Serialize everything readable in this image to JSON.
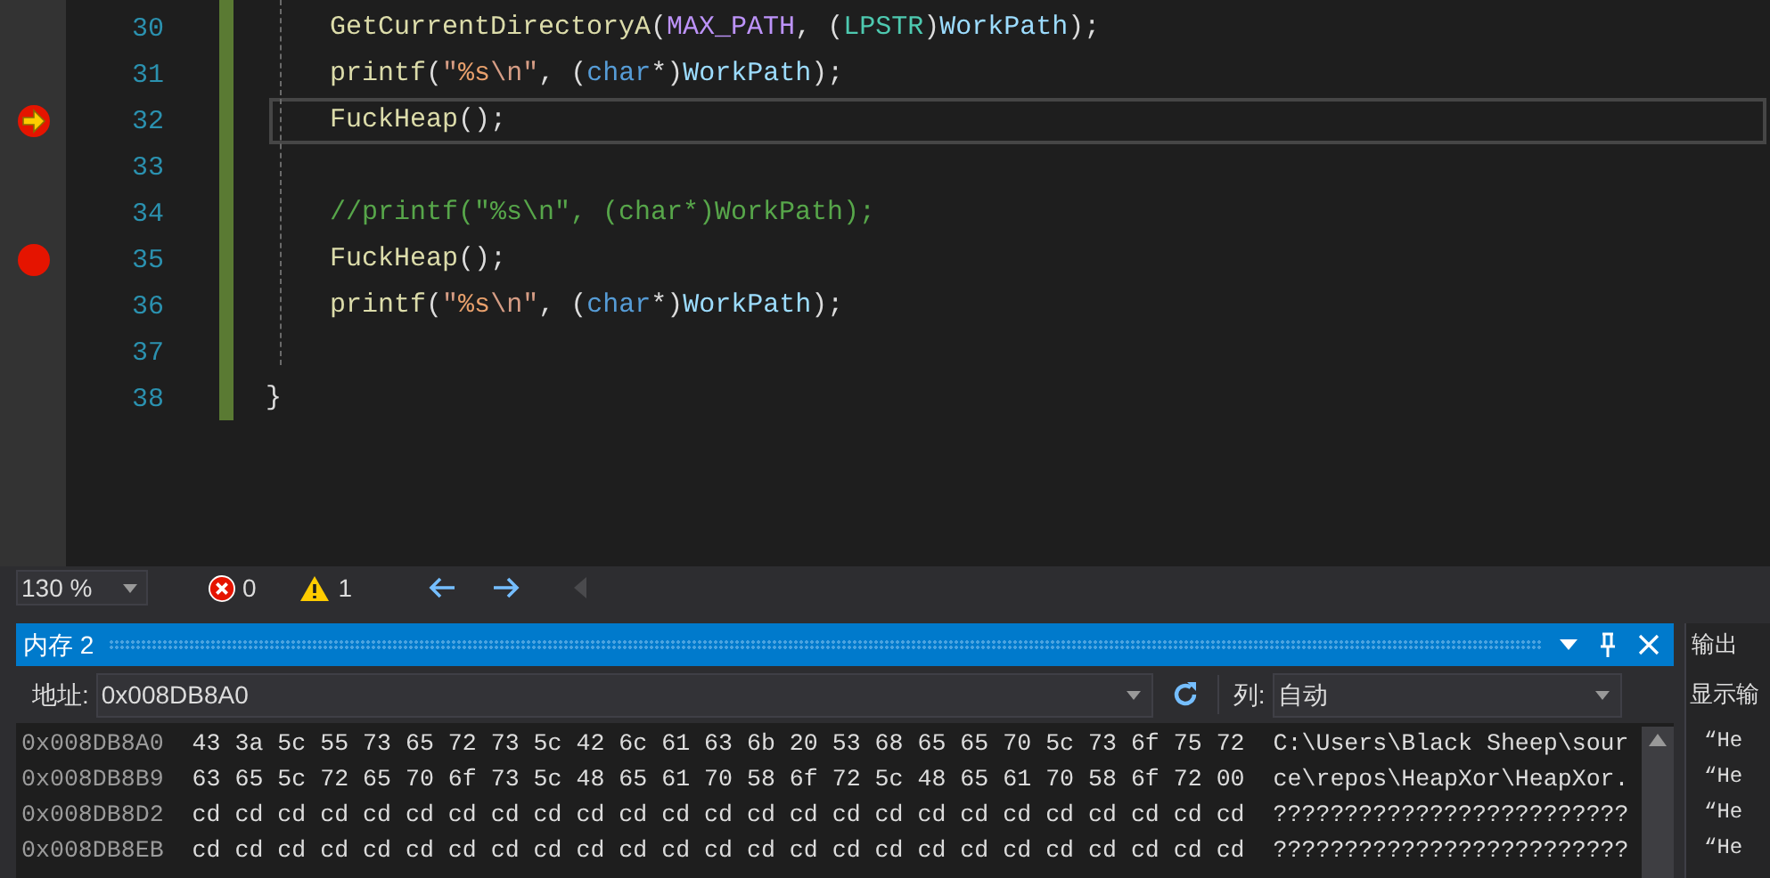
{
  "editor": {
    "lines": [
      {
        "number": "30",
        "breakpoint": false,
        "current": false,
        "tokens": [
          {
            "text": "GetCurrentDirectoryA",
            "kind": "func"
          },
          {
            "text": "(",
            "kind": "plain"
          },
          {
            "text": "MAX_PATH",
            "kind": "macro"
          },
          {
            "text": ", (",
            "kind": "plain"
          },
          {
            "text": "LPSTR",
            "kind": "type"
          },
          {
            "text": ")",
            "kind": "plain"
          },
          {
            "text": "WorkPath",
            "kind": "var"
          },
          {
            "text": ");",
            "kind": "plain"
          }
        ]
      },
      {
        "number": "31",
        "breakpoint": false,
        "current": false,
        "tokens": [
          {
            "text": "printf",
            "kind": "func"
          },
          {
            "text": "(",
            "kind": "plain"
          },
          {
            "text": "\"",
            "kind": "string"
          },
          {
            "text": "%s",
            "kind": "format"
          },
          {
            "text": "\\n\"",
            "kind": "string"
          },
          {
            "text": ", (",
            "kind": "plain"
          },
          {
            "text": "char",
            "kind": "keyword"
          },
          {
            "text": "*)",
            "kind": "plain"
          },
          {
            "text": "WorkPath",
            "kind": "var"
          },
          {
            "text": ");",
            "kind": "plain"
          }
        ]
      },
      {
        "number": "32",
        "breakpoint": true,
        "current": true,
        "tokens": [
          {
            "text": "FuckHeap",
            "kind": "func"
          },
          {
            "text": "();",
            "kind": "plain"
          }
        ]
      },
      {
        "number": "33",
        "breakpoint": false,
        "current": false
      },
      {
        "number": "34",
        "breakpoint": false,
        "current": false,
        "tokens": [
          {
            "text": "//printf(\"%s\\n\", (char*)WorkPath);",
            "kind": "comment"
          }
        ]
      },
      {
        "number": "35",
        "breakpoint": true,
        "current": false,
        "tokens": [
          {
            "text": "FuckHeap",
            "kind": "func"
          },
          {
            "text": "();",
            "kind": "plain"
          }
        ]
      },
      {
        "number": "36",
        "breakpoint": false,
        "current": false,
        "tokens": [
          {
            "text": "printf",
            "kind": "func"
          },
          {
            "text": "(",
            "kind": "plain"
          },
          {
            "text": "\"",
            "kind": "string"
          },
          {
            "text": "%s",
            "kind": "format"
          },
          {
            "text": "\\n\"",
            "kind": "string"
          },
          {
            "text": ", (",
            "kind": "plain"
          },
          {
            "text": "char",
            "kind": "keyword"
          },
          {
            "text": "*)",
            "kind": "plain"
          },
          {
            "text": "WorkPath",
            "kind": "var"
          },
          {
            "text": ");",
            "kind": "plain"
          }
        ]
      },
      {
        "number": "37",
        "breakpoint": false,
        "current": false
      },
      {
        "number": "38",
        "breakpoint": false,
        "current": false,
        "brace": "}"
      }
    ]
  },
  "status_bar": {
    "zoom": "130 %",
    "errors": "0",
    "warnings": "1"
  },
  "memory": {
    "title": "内存 2",
    "address_label": "地址:",
    "address": "0x008DB8A0",
    "columns_label": "列:",
    "columns": "自动",
    "rows": [
      {
        "address": "0x008DB8A0",
        "bytes": "43 3a 5c 55 73 65 72 73 5c 42 6c 61 63 6b 20 53 68 65 65 70 5c 73 6f 75 72",
        "ascii": "C:\\Users\\Black Sheep\\sour"
      },
      {
        "address": "0x008DB8B9",
        "bytes": "63 65 5c 72 65 70 6f 73 5c 48 65 61 70 58 6f 72 5c 48 65 61 70 58 6f 72 00",
        "ascii": "ce\\repos\\HeapXor\\HeapXor."
      },
      {
        "address": "0x008DB8D2",
        "bytes": "cd cd cd cd cd cd cd cd cd cd cd cd cd cd cd cd cd cd cd cd cd cd cd cd cd",
        "ascii": "?????????????????????????"
      },
      {
        "address": "0x008DB8EB",
        "bytes": "cd cd cd cd cd cd cd cd cd cd cd cd cd cd cd cd cd cd cd cd cd cd cd cd cd",
        "ascii": "?????????????????????????"
      }
    ]
  },
  "output": {
    "title": "输出",
    "show_label": "显示输",
    "lines": [
      "“He",
      "“He",
      "“He",
      "“He"
    ]
  }
}
